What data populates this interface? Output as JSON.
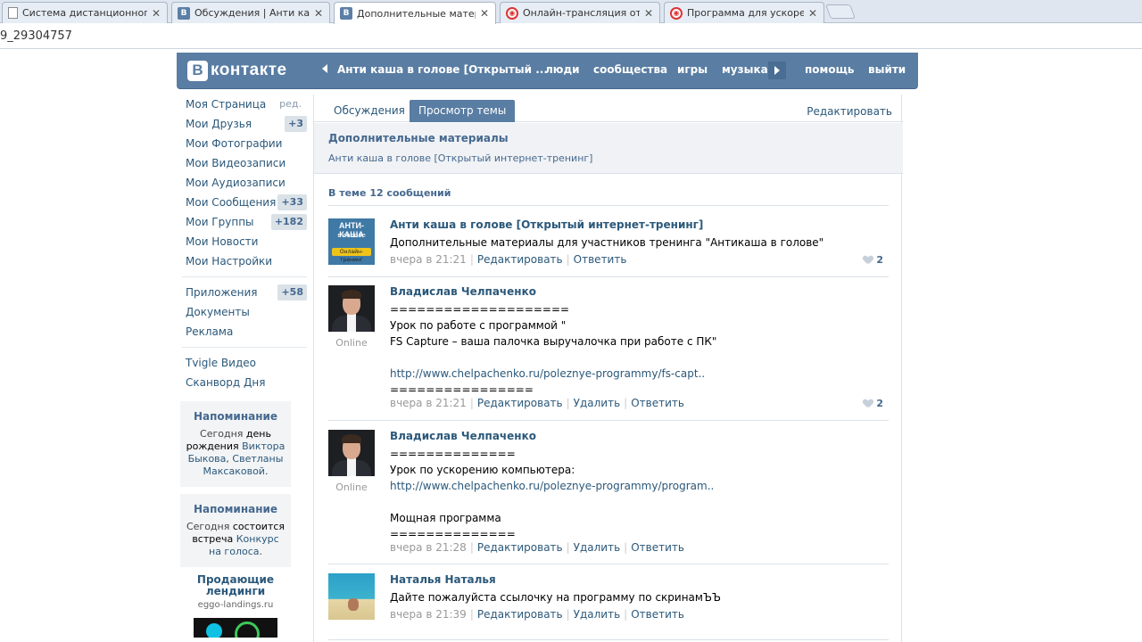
{
  "browser": {
    "tabs": [
      {
        "title": "Система дистанционног",
        "icon": "doc"
      },
      {
        "title": "Обсуждения | Анти каша",
        "icon": "vk"
      },
      {
        "title": "Дополнительные матери",
        "icon": "vk"
      },
      {
        "title": "Онлайн-трансляция отк",
        "icon": "red"
      },
      {
        "title": "Программа для ускорен",
        "icon": "red"
      }
    ],
    "address": "9_29304757"
  },
  "header": {
    "logo_letter": "В",
    "logo_text": "контакте",
    "current": "Анти каша в голове [Открытый ...",
    "nav": [
      "люди",
      "сообщества",
      "игры",
      "музыка"
    ],
    "help": "помощь",
    "logout": "выйти"
  },
  "sidebar": {
    "items": [
      {
        "label": "Моя Страница",
        "extra": "ред."
      },
      {
        "label": "Мои Друзья",
        "count": "+3"
      },
      {
        "label": "Мои Фотографии"
      },
      {
        "label": "Мои Видеозаписи"
      },
      {
        "label": "Мои Аудиозаписи"
      },
      {
        "label": "Мои Сообщения",
        "count": "+33"
      },
      {
        "label": "Мои Группы",
        "count": "+182"
      },
      {
        "label": "Мои Новости"
      },
      {
        "label": "Мои Настройки"
      }
    ],
    "items2": [
      {
        "label": "Приложения",
        "count": "+58"
      },
      {
        "label": "Документы"
      },
      {
        "label": "Реклама"
      }
    ],
    "items3": [
      {
        "label": "Tvigle Видео"
      },
      {
        "label": "Сканворд Дня"
      }
    ],
    "reminders": [
      {
        "title": "Напоминание",
        "t1": "Сегодня ",
        "b1": "день рождения",
        "t2": " ",
        "l1": "Виктора Быкова",
        "t3": ", ",
        "l2": "Светланы Максаковой",
        "t4": "."
      },
      {
        "title": "Напоминание",
        "t1": "Сегодня ",
        "b1": "состоится встреча",
        "t2": " ",
        "l1": "Конкурс на голоса",
        "t3": "",
        "l2": "",
        "t4": "."
      }
    ],
    "ad": {
      "title": "Продающие лендинги",
      "url": "eggo-landings.ru"
    }
  },
  "main": {
    "tabs": [
      "Обсуждения",
      "Просмотр темы"
    ],
    "edit": "Редактировать",
    "topic_title": "Дополнительные материалы",
    "topic_sub": "Анти каша в голове [Открытый интернет-тренинг]",
    "count_line": "В теме 12 сообщений",
    "avatar_group": {
      "line1": "АНТИ-КАША",
      "line2": "в голове",
      "line3": "Онлайн-тренинг"
    },
    "posts": [
      {
        "author": "Анти каша в голове [Открытый интернет-тренинг]",
        "lines": [
          "Дополнительные материалы для участников тренинга \"Антикаша в голове\""
        ],
        "time": "вчера в 21:21",
        "actions": [
          "Редактировать",
          "Ответить"
        ],
        "likes": "2",
        "online": ""
      },
      {
        "author": "Владислав Челпаченко",
        "lines": [
          "====================",
          "Урок по работе с программой \"",
          "FS Capture – ваша палочка выручалочка при работе с ПК\"",
          "",
          "http://www.chelpachenko.ru/poleznye-programmy/fs-capt..",
          "================"
        ],
        "time": "вчера в 21:21",
        "actions": [
          "Редактировать",
          "Удалить",
          "Ответить"
        ],
        "likes": "2",
        "online": "Online"
      },
      {
        "author": "Владислав Челпаченко",
        "lines": [
          "==============",
          "Урок по ускорению компьютера:",
          "http://www.chelpachenko.ru/poleznye-programmy/program..",
          "",
          "Мощная программа",
          "=============="
        ],
        "time": "вчера в 21:28",
        "actions": [
          "Редактировать",
          "Удалить",
          "Ответить"
        ],
        "likes": "",
        "online": "Online"
      },
      {
        "author": "Наталья Наталья",
        "lines": [
          "Дайте пожалуйста ссылочку на программу по скринамЪЪ"
        ],
        "time": "вчера в 21:39",
        "actions": [
          "Редактировать",
          "Удалить",
          "Ответить"
        ],
        "likes": "",
        "online": ""
      }
    ]
  }
}
